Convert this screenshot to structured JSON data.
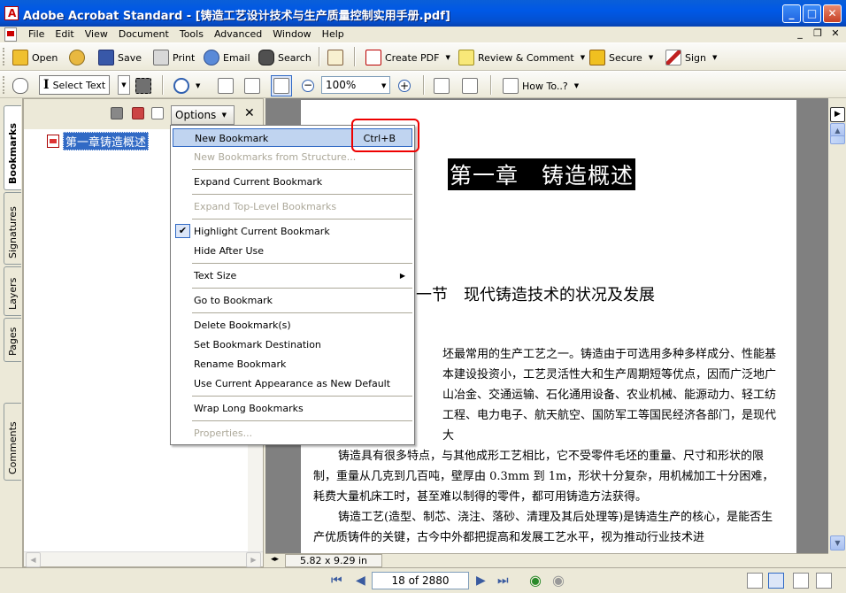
{
  "window": {
    "title": "Adobe Acrobat Standard - [铸造工艺设计技术与生产质量控制实用手册.pdf]",
    "minimize": "_",
    "maximize": "□",
    "close": "✕"
  },
  "menubar": {
    "items": [
      "File",
      "Edit",
      "View",
      "Document",
      "Tools",
      "Advanced",
      "Window",
      "Help"
    ],
    "mdi": [
      "_",
      "❐",
      "✕"
    ]
  },
  "toolbar1": {
    "open": "Open",
    "print": "Print",
    "save": "Save",
    "email": "Email",
    "search": "Search",
    "create_pdf": "Create PDF",
    "review": "Review & Comment",
    "secure": "Secure",
    "sign": "Sign"
  },
  "toolbar2": {
    "select_text": "Select Text",
    "zoom": "100%",
    "how_to": "How To..?"
  },
  "side_tabs": [
    "Bookmarks",
    "Signatures",
    "Layers",
    "Pages",
    "Comments"
  ],
  "bookmarks_panel": {
    "options_label": "Options",
    "close": "✕",
    "items": [
      {
        "label": "第一章铸造概述"
      }
    ]
  },
  "options_menu": {
    "items": [
      {
        "label": "New Bookmark",
        "shortcut": "Ctrl+B"
      },
      {
        "label": "New Bookmarks from Structure..."
      },
      {
        "label": "Expand Current Bookmark"
      },
      {
        "label": "Expand Top-Level Bookmarks"
      },
      {
        "label": "Highlight Current Bookmark"
      },
      {
        "label": "Hide After Use"
      },
      {
        "label": "Text Size"
      },
      {
        "label": "Go to Bookmark"
      },
      {
        "label": "Delete Bookmark(s)"
      },
      {
        "label": "Set Bookmark Destination"
      },
      {
        "label": "Rename Bookmark"
      },
      {
        "label": "Use Current Appearance as New Default"
      },
      {
        "label": "Wrap Long Bookmarks"
      },
      {
        "label": "Properties..."
      }
    ]
  },
  "document": {
    "chapter": "第一章　铸造概述",
    "section": "一节　现代铸造技术的状况及发展",
    "paragraph1": "坯最常用的生产工艺之一。铸造由于可选用多种多样成分、性能基本建设投资小，工艺灵活性大和生产周期短等优点，因而广泛地广山冶金、交通运输、石化通用设备、农业机械、能源动力、轻工纺工程、电力电子、航天航空、国防军工等国民经济各部门，是现代大",
    "paragraph2": "铸造具有很多特点，与其他成形工艺相比，它不受零件毛坯的重量、尺寸和形状的限制，重量从几克到几百吨，壁厚由 0.3mm 到 1m，形状十分复杂，用机械加工十分困难，耗费大量机床工时，甚至难以制得的零件，都可用铸造方法获得。",
    "paragraph3": "铸造工艺(造型、制芯、浇注、落砂、清理及其后处理等)是铸造生产的核心，是能否生产优质铸件的关键，古今中外都把提高和发展工艺水平，视为推动行业技术进",
    "page_size": "5.82 x 9.29 in"
  },
  "statusbar": {
    "page": "18 of 2880"
  }
}
